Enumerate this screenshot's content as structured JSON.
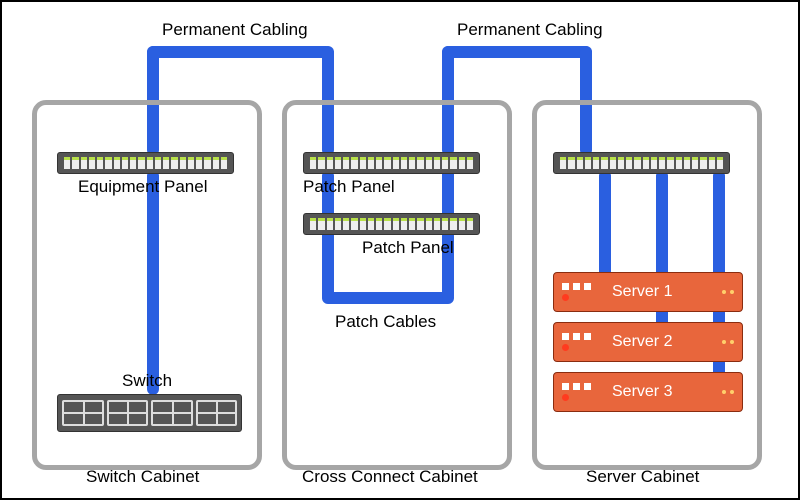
{
  "labels": {
    "perm_cabling_left": "Permanent Cabling",
    "perm_cabling_right": "Permanent Cabling",
    "equipment_panel": "Equipment Panel",
    "patch_panel_1": "Patch Panel",
    "patch_panel_2": "Patch Panel",
    "patch_cables": "Patch Cables",
    "switch": "Switch"
  },
  "cabinets": {
    "left": "Switch Cabinet",
    "middle": "Cross Connect Cabinet",
    "right": "Server Cabinet"
  },
  "servers": [
    "Server 1",
    "Server 2",
    "Server 3"
  ],
  "colors": {
    "cable": "#2a5fe0",
    "cabinet_border": "#a6a6a6",
    "server": "#e8663c"
  }
}
